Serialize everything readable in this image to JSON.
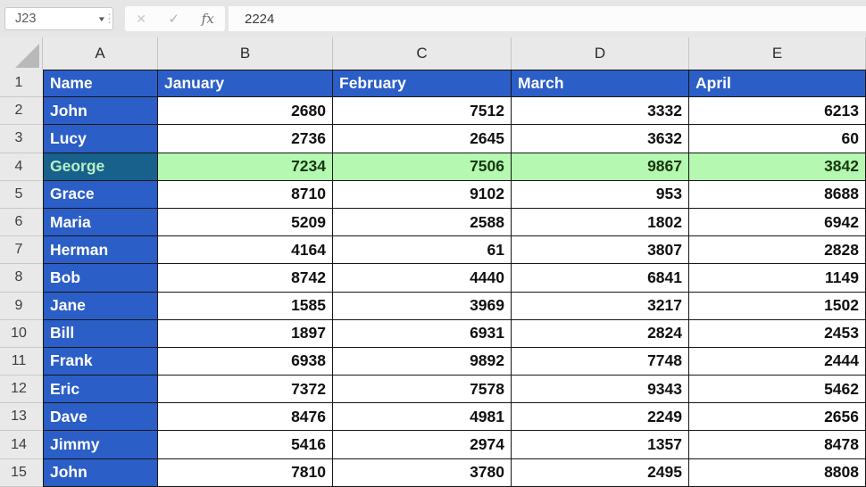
{
  "formula_bar": {
    "name_box": "J23",
    "formula": "2224",
    "cancel_glyph": "✕",
    "enter_glyph": "✓",
    "fx_label": "fx"
  },
  "colors": {
    "chrome_bg": "#e6e6e6",
    "header_bg": "#e9e9e9",
    "header_blue": "#2b5ec6",
    "highlight_green": "#b5f8b1",
    "highlight_green_text": "#17380f",
    "highlight_teal": "#17618c",
    "highlight_teal_text": "#b9efc4",
    "cell_border": "#161616"
  },
  "sheet": {
    "column_headers": [
      "A",
      "B",
      "C",
      "D",
      "E"
    ],
    "header_row": {
      "row": 1,
      "cells": [
        "Name",
        "January",
        "February",
        "March",
        "April"
      ]
    },
    "highlighted_row": 4,
    "rows": [
      {
        "row": 2,
        "name": "John",
        "values": [
          2680,
          7512,
          3332,
          6213
        ]
      },
      {
        "row": 3,
        "name": "Lucy",
        "values": [
          2736,
          2645,
          3632,
          60
        ]
      },
      {
        "row": 4,
        "name": "George",
        "values": [
          7234,
          7506,
          9867,
          3842
        ]
      },
      {
        "row": 5,
        "name": "Grace",
        "values": [
          8710,
          9102,
          953,
          8688
        ]
      },
      {
        "row": 6,
        "name": "Maria",
        "values": [
          5209,
          2588,
          1802,
          6942
        ]
      },
      {
        "row": 7,
        "name": "Herman",
        "values": [
          4164,
          61,
          3807,
          2828
        ]
      },
      {
        "row": 8,
        "name": "Bob",
        "values": [
          8742,
          4440,
          6841,
          1149
        ]
      },
      {
        "row": 9,
        "name": "Jane",
        "values": [
          1585,
          3969,
          3217,
          1502
        ]
      },
      {
        "row": 10,
        "name": "Bill",
        "values": [
          1897,
          6931,
          2824,
          2453
        ]
      },
      {
        "row": 11,
        "name": "Frank",
        "values": [
          6938,
          9892,
          7748,
          2444
        ]
      },
      {
        "row": 12,
        "name": "Eric",
        "values": [
          7372,
          7578,
          9343,
          5462
        ]
      },
      {
        "row": 13,
        "name": "Dave",
        "values": [
          8476,
          4981,
          2249,
          2656
        ]
      },
      {
        "row": 14,
        "name": "Jimmy",
        "values": [
          5416,
          2974,
          1357,
          8478
        ]
      },
      {
        "row": 15,
        "name": "John",
        "values": [
          7810,
          3780,
          2495,
          8808
        ]
      }
    ]
  }
}
